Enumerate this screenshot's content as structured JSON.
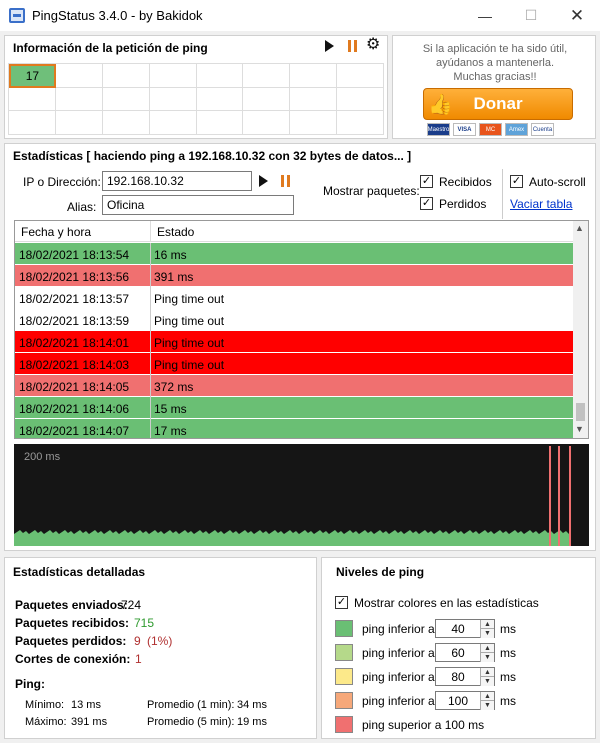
{
  "window": {
    "title": "PingStatus 3.4.0 - by Bakidok",
    "minimize": "—",
    "maximize": "☐",
    "close": "✕"
  },
  "ping_info": {
    "title": "Información de la petición de ping",
    "grid_first_value": "17"
  },
  "donate": {
    "line1": "Si la aplicación te ha sido útil,",
    "line2": "ayúdanos a mantenerla.",
    "line3": "Muchas gracias!!",
    "button_label": "Donar",
    "cards": [
      "Maestro",
      "VISA",
      "MC",
      "Amex",
      "Cuenta"
    ]
  },
  "stats": {
    "title": "Estadísticas  [ haciendo ping a 192.168.10.32 con 32 bytes de datos... ]",
    "ip_label": "IP o Dirección:",
    "ip_value": "192.168.10.32",
    "alias_label": "Alias:",
    "alias_value": "Oficina",
    "show_packets_label": "Mostrar paquetes:",
    "received_label": "Recibidos",
    "lost_label": "Perdidos",
    "autoscroll_label": "Auto-scroll",
    "clear_table_label": "Vaciar tabla"
  },
  "table": {
    "headers": [
      "Fecha y hora",
      "Estado"
    ],
    "rows": [
      {
        "date": "18/02/2021   18:13:54",
        "state": "16 ms",
        "color": "#6abf74"
      },
      {
        "date": "18/02/2021   18:13:56",
        "state": "391 ms",
        "color": "#f07070"
      },
      {
        "date": "18/02/2021   18:13:57",
        "state": "Ping time out",
        "color": "#ffffff"
      },
      {
        "date": "18/02/2021   18:13:59",
        "state": "Ping time out",
        "color": "#ffffff"
      },
      {
        "date": "18/02/2021   18:14:01",
        "state": "Ping time out",
        "color": "#ff0000"
      },
      {
        "date": "18/02/2021   18:14:03",
        "state": "Ping time out",
        "color": "#ff0000"
      },
      {
        "date": "18/02/2021   18:14:05",
        "state": "372 ms",
        "color": "#f07070"
      },
      {
        "date": "18/02/2021   18:14:06",
        "state": "15 ms",
        "color": "#6abf74"
      },
      {
        "date": "18/02/2021   18:14:07",
        "state": "17 ms",
        "color": "#6abf74"
      }
    ]
  },
  "graph": {
    "label": "200 ms",
    "base_color": "#6abf74",
    "spike_color": "#f07070"
  },
  "detail": {
    "title": "Estadísticas detalladas",
    "sent_label": "Paquetes enviados:",
    "sent_value": "724",
    "recv_label": "Paquetes recibidos:",
    "recv_value": "715",
    "lost_label": "Paquetes perdidos:",
    "lost_value": "9",
    "lost_pct": "(1%)",
    "cuts_label": "Cortes de conexión:",
    "cuts_value": "1",
    "ping_label": "Ping:",
    "min_label": "Mínimo:",
    "min_value": "13 ms",
    "max_label": "Máximo:",
    "max_value": "391 ms",
    "avg1_label": "Promedio (1 min):",
    "avg1_value": "34 ms",
    "avg5_label": "Promedio (5 min):",
    "avg5_value": "19 ms"
  },
  "levels": {
    "title": "Niveles de ping",
    "show_colors_label": "Mostrar colores en las estadísticas",
    "items": [
      {
        "label": "ping inferior a",
        "value": "40",
        "unit": "ms",
        "color": "#6abf74"
      },
      {
        "label": "ping inferior a",
        "value": "60",
        "unit": "ms",
        "color": "#b5d98a"
      },
      {
        "label": "ping inferior a",
        "value": "80",
        "unit": "ms",
        "color": "#fce98a"
      },
      {
        "label": "ping inferior a",
        "value": "100",
        "unit": "ms",
        "color": "#f6a87a"
      },
      {
        "label": "ping superior a 100 ms",
        "color": "#f07070"
      }
    ]
  }
}
